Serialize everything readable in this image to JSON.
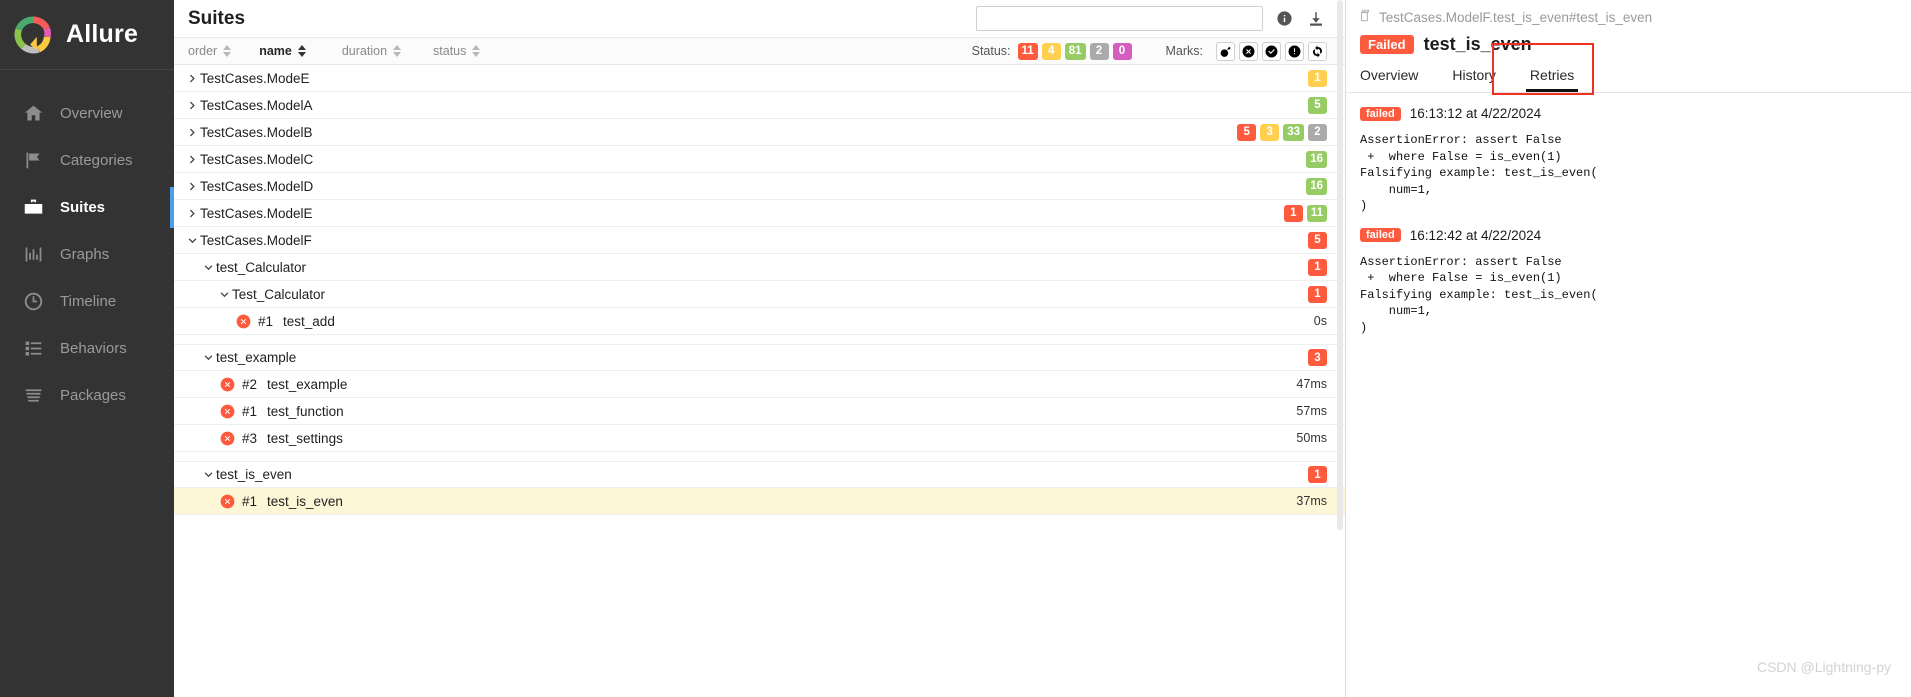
{
  "sidebar": {
    "brand": "Allure",
    "brand_logo_icon": "allure-donut-logo",
    "items": [
      {
        "label": "Overview",
        "icon": "home-icon",
        "active": false
      },
      {
        "label": "Categories",
        "icon": "flag-icon",
        "active": false
      },
      {
        "label": "Suites",
        "icon": "briefcase-icon",
        "active": true
      },
      {
        "label": "Graphs",
        "icon": "bar-chart-icon",
        "active": false
      },
      {
        "label": "Timeline",
        "icon": "clock-icon",
        "active": false
      },
      {
        "label": "Behaviors",
        "icon": "list-icon",
        "active": false
      },
      {
        "label": "Packages",
        "icon": "layers-icon",
        "active": false
      }
    ]
  },
  "center": {
    "title": "Suites",
    "search": {
      "value": "",
      "placeholder": ""
    },
    "info_icon": "info-icon",
    "download_icon": "download-icon",
    "sort_columns": [
      {
        "label": "order",
        "selected": false
      },
      {
        "label": "name",
        "selected": true
      },
      {
        "label": "duration",
        "selected": false
      },
      {
        "label": "status",
        "selected": false
      }
    ],
    "status_label": "Status:",
    "status_chips": [
      {
        "value": "11",
        "color": "#fd5a3e"
      },
      {
        "value": "4",
        "color": "#ffd050"
      },
      {
        "value": "81",
        "color": "#97cc64"
      },
      {
        "value": "2",
        "color": "#aaaaaa"
      },
      {
        "value": "0",
        "color": "#d35ebe"
      }
    ],
    "marks_label": "Marks:",
    "marks": [
      {
        "icon": "bomb-icon"
      },
      {
        "icon": "x-circle-icon"
      },
      {
        "icon": "check-circle-icon"
      },
      {
        "icon": "exclamation-circle-icon"
      },
      {
        "icon": "retry-refresh-icon"
      }
    ],
    "rows": [
      {
        "label": "TestCases.ModeE",
        "indent": 0,
        "chevron": "right",
        "chips": [
          {
            "value": "1",
            "color": "#ffd050"
          }
        ]
      },
      {
        "label": "TestCases.ModelA",
        "indent": 0,
        "chevron": "right",
        "chips": [
          {
            "value": "5",
            "color": "#97cc64"
          }
        ]
      },
      {
        "label": "TestCases.ModelB",
        "indent": 0,
        "chevron": "right",
        "chips": [
          {
            "value": "5",
            "color": "#fd5a3e"
          },
          {
            "value": "3",
            "color": "#ffd050"
          },
          {
            "value": "33",
            "color": "#97cc64"
          },
          {
            "value": "2",
            "color": "#aaaaaa"
          }
        ]
      },
      {
        "label": "TestCases.ModelC",
        "indent": 0,
        "chevron": "right",
        "chips": [
          {
            "value": "16",
            "color": "#97cc64"
          }
        ]
      },
      {
        "label": "TestCases.ModelD",
        "indent": 0,
        "chevron": "right",
        "chips": [
          {
            "value": "16",
            "color": "#97cc64"
          }
        ]
      },
      {
        "label": "TestCases.ModelE",
        "indent": 0,
        "chevron": "right",
        "chips": [
          {
            "value": "1",
            "color": "#fd5a3e"
          },
          {
            "value": "11",
            "color": "#97cc64"
          }
        ]
      },
      {
        "label": "TestCases.ModelF",
        "indent": 0,
        "chevron": "down",
        "chips": [
          {
            "value": "5",
            "color": "#fd5a3e"
          }
        ]
      },
      {
        "label": "test_Calculator",
        "indent": 1,
        "chevron": "down",
        "chips": [
          {
            "value": "1",
            "color": "#fd5a3e"
          }
        ]
      },
      {
        "label": "Test_Calculator",
        "indent": 2,
        "chevron": "down",
        "chips": [
          {
            "value": "1",
            "color": "#fd5a3e"
          }
        ]
      },
      {
        "label": "test_add",
        "indent": 3,
        "leaf": true,
        "status_icon": "failed-x-icon",
        "number": "#1",
        "duration": "0s"
      },
      {
        "label": "test_example",
        "indent": 1,
        "chevron": "down",
        "gap": true,
        "chips": [
          {
            "value": "3",
            "color": "#fd5a3e"
          }
        ]
      },
      {
        "label": "test_example",
        "indent": 2,
        "leaf": true,
        "status_icon": "failed-x-icon",
        "number": "#2",
        "duration": "47ms"
      },
      {
        "label": "test_function",
        "indent": 2,
        "leaf": true,
        "status_icon": "failed-x-icon",
        "number": "#1",
        "duration": "57ms"
      },
      {
        "label": "test_settings",
        "indent": 2,
        "leaf": true,
        "status_icon": "failed-x-icon",
        "number": "#3",
        "duration": "50ms"
      },
      {
        "label": "test_is_even",
        "indent": 1,
        "chevron": "down",
        "gap": true,
        "chips": [
          {
            "value": "1",
            "color": "#fd5a3e"
          }
        ]
      },
      {
        "label": "test_is_even",
        "indent": 2,
        "leaf": true,
        "status_icon": "failed-x-icon",
        "number": "#1",
        "duration": "37ms",
        "highlighted": true
      }
    ]
  },
  "right": {
    "breadcrumb": "TestCases.ModelF.test_is_even#test_is_even",
    "breadcrumb_icon": "copy-icon",
    "status_badge": "Failed",
    "title": "test_is_even",
    "tabs": [
      {
        "label": "Overview",
        "active": false
      },
      {
        "label": "History",
        "active": false
      },
      {
        "label": "Retries",
        "active": true
      }
    ],
    "retries": [
      {
        "status": "failed",
        "time": "16:13:12 at 4/22/2024",
        "trace": "AssertionError: assert False\n +  where False = is_even(1)\nFalsifying example: test_is_even(\n    num=1,\n)"
      },
      {
        "status": "failed",
        "time": "16:12:42 at 4/22/2024",
        "trace": "AssertionError: assert False\n +  where False = is_even(1)\nFalsifying example: test_is_even(\n    num=1,\n)"
      }
    ],
    "watermark": "CSDN @Lightning-py",
    "highlight_color": "#ef3124"
  }
}
